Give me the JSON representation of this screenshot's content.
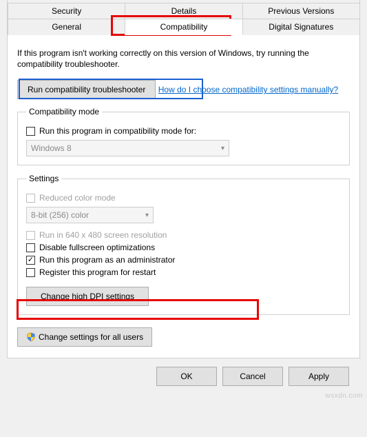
{
  "tabs": {
    "row1": [
      "Security",
      "Details",
      "Previous Versions"
    ],
    "row2": [
      "General",
      "Compatibility",
      "Digital Signatures"
    ],
    "active": "Compatibility"
  },
  "intro": "If this program isn't working correctly on this version of Windows, try running the compatibility troubleshooter.",
  "troubleshooter_btn": "Run compatibility troubleshooter",
  "manual_link": "How do I choose compatibility settings manually?",
  "compat_mode": {
    "legend": "Compatibility mode",
    "checkbox": "Run this program in compatibility mode for:",
    "combo": "Windows 8"
  },
  "settings": {
    "legend": "Settings",
    "reduced_color": "Reduced color mode",
    "color_combo": "8-bit (256) color",
    "low_res": "Run in 640 x 480 screen resolution",
    "disable_fullscreen": "Disable fullscreen optimizations",
    "run_admin": "Run this program as an administrator",
    "register_restart": "Register this program for restart",
    "dpi_btn": "Change high DPI settings"
  },
  "all_users_btn": "Change settings for all users",
  "footer": {
    "ok": "OK",
    "cancel": "Cancel",
    "apply": "Apply"
  },
  "watermark": "wsxdn.com"
}
